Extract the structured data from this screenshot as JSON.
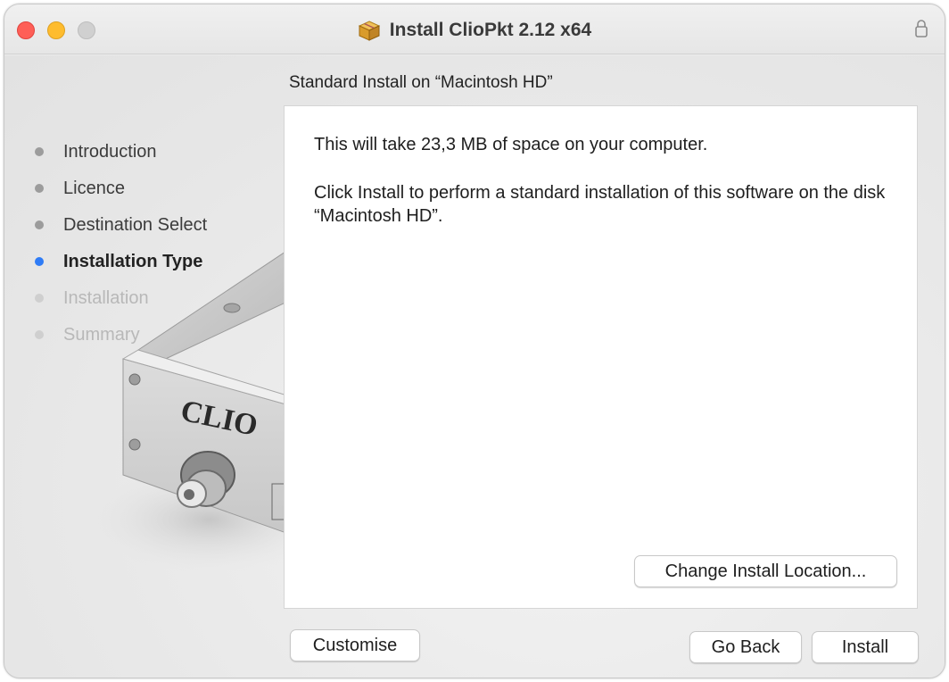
{
  "window": {
    "title": "Install ClioPkt 2.12 x64"
  },
  "sidebar": {
    "steps": [
      {
        "label": "Introduction",
        "state": "done"
      },
      {
        "label": "Licence",
        "state": "done"
      },
      {
        "label": "Destination Select",
        "state": "done"
      },
      {
        "label": "Installation Type",
        "state": "active"
      },
      {
        "label": "Installation",
        "state": "future"
      },
      {
        "label": "Summary",
        "state": "future"
      }
    ]
  },
  "device_art": {
    "brand_text": "CLIO"
  },
  "main": {
    "heading": "Standard Install on “Macintosh HD”",
    "space_text": "This will take 23,3 MB of space on your computer.",
    "install_text": "Click Install to perform a standard installation of this software on the disk “Macintosh HD”.",
    "change_location_label": "Change Install Location..."
  },
  "footer": {
    "customise_label": "Customise",
    "go_back_label": "Go Back",
    "install_label": "Install"
  },
  "colors": {
    "accent": "#2f7cf6",
    "close": "#fe5f57",
    "minimize": "#febc2e",
    "zoom": "#d0d0d0"
  },
  "icons": {
    "title": "package-icon",
    "lock": "lock-icon"
  }
}
